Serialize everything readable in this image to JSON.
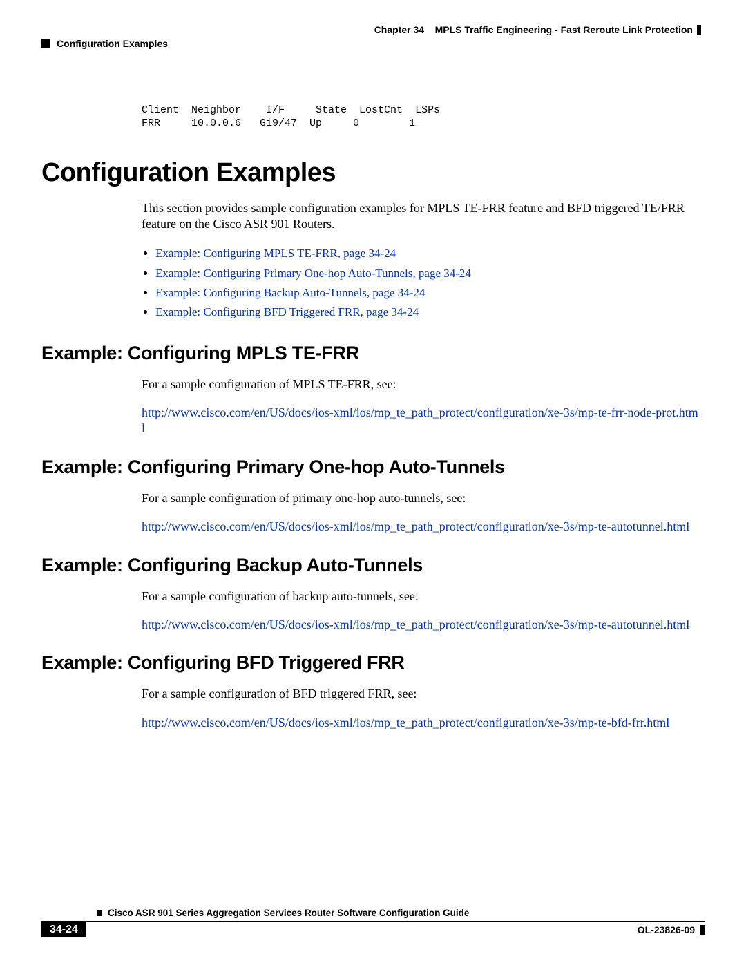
{
  "header": {
    "chapter_label": "Chapter 34",
    "chapter_title": "MPLS Traffic Engineering - Fast Reroute Link Protection",
    "section_breadcrumb": "Configuration Examples"
  },
  "code_block": "Client  Neighbor    I/F     State  LostCnt  LSPs\nFRR     10.0.0.6   Gi9/47  Up     0        1",
  "main_heading": "Configuration Examples",
  "intro_paragraph": "This section provides sample configuration examples for MPLS TE-FRR feature and BFD triggered TE/FRR feature on the Cisco ASR 901 Routers.",
  "toc_links": [
    "Example: Configuring MPLS TE-FRR, page 34-24",
    "Example: Configuring Primary One-hop Auto-Tunnels, page 34-24",
    "Example: Configuring Backup Auto-Tunnels, page 34-24",
    "Example: Configuring BFD Triggered FRR, page 34-24"
  ],
  "sections": [
    {
      "title": "Example: Configuring MPLS TE-FRR",
      "body": "For a sample configuration of MPLS TE-FRR, see:",
      "link": "http://www.cisco.com/en/US/docs/ios-xml/ios/mp_te_path_protect/configuration/xe-3s/mp-te-frr-node-prot.html"
    },
    {
      "title": "Example: Configuring Primary One-hop Auto-Tunnels",
      "body": "For a sample configuration of primary one-hop auto-tunnels, see:",
      "link": "http://www.cisco.com/en/US/docs/ios-xml/ios/mp_te_path_protect/configuration/xe-3s/mp-te-autotunnel.html"
    },
    {
      "title": "Example: Configuring Backup Auto-Tunnels",
      "body": "For a sample configuration of backup auto-tunnels, see:",
      "link": "http://www.cisco.com/en/US/docs/ios-xml/ios/mp_te_path_protect/configuration/xe-3s/mp-te-autotunnel.html"
    },
    {
      "title": "Example: Configuring BFD Triggered FRR",
      "body": "For a sample configuration of BFD triggered FRR, see:",
      "link": "http://www.cisco.com/en/US/docs/ios-xml/ios/mp_te_path_protect/configuration/xe-3s/mp-te-bfd-frr.html"
    }
  ],
  "footer": {
    "guide_title": "Cisco ASR 901 Series Aggregation Services Router Software Configuration Guide",
    "page_number": "34-24",
    "doc_id": "OL-23826-09"
  }
}
